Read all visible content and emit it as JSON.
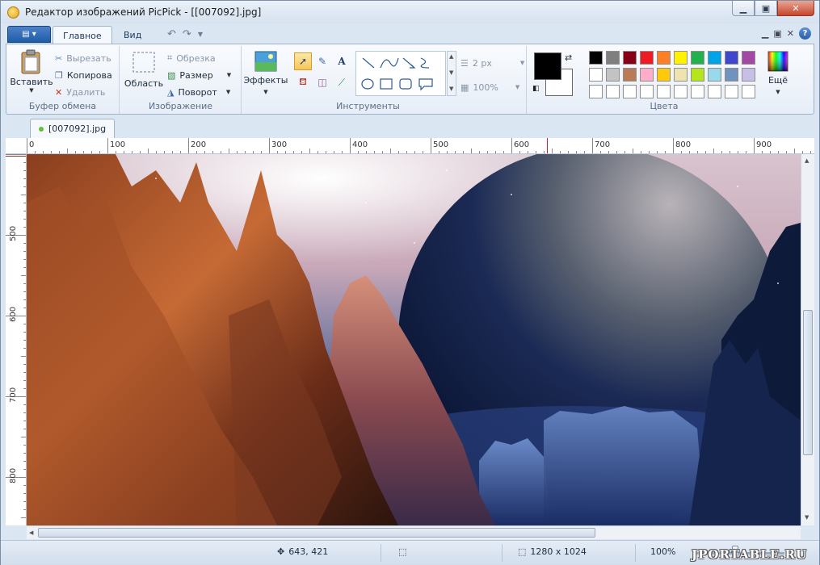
{
  "window": {
    "title": "Редактор изображений PicPick - [[007092].jpg]",
    "minimize_icon": "minimize-icon",
    "maximize_icon": "maximize-icon",
    "close_icon": "close-icon"
  },
  "ribbon_tabs": {
    "file_menu_icon": "menu-icon",
    "tabs": [
      {
        "label": "Главное",
        "active": true
      },
      {
        "label": "Вид",
        "active": false
      }
    ]
  },
  "clipboard_group": {
    "paste_label": "Вставить",
    "cut_label": "Вырезать",
    "copy_label": "Копирова",
    "delete_label": "Удалить",
    "group_label": "Буфер обмена"
  },
  "image_group": {
    "area_label": "Область",
    "crop_label": "Обрезка",
    "resize_label": "Размер",
    "rotate_label": "Поворот",
    "group_label": "Изображение"
  },
  "effects_group": {
    "effects_label": "Эффекты"
  },
  "tools_group": {
    "group_label": "Инструменты",
    "line_width": "2 px",
    "opacity": "100%"
  },
  "colors_group": {
    "group_label": "Цвета",
    "more_label": "Ещё",
    "primary_color": "#000000",
    "secondary_color": "#ffffff",
    "palette_row1": [
      "#000000",
      "#7f7f7f",
      "#880015",
      "#ed1c24",
      "#ff7f27",
      "#fff200",
      "#22b14c",
      "#00a2e8",
      "#3f48cc",
      "#a349a4"
    ],
    "palette_row2": [
      "#ffffff",
      "#c3c3c3",
      "#b97a57",
      "#ffaec9",
      "#ffc90e",
      "#efe4b0",
      "#b5e61d",
      "#99d9ea",
      "#7092be",
      "#c8bfe7"
    ],
    "palette_row3": [
      "#ffffff",
      "#ffffff",
      "#ffffff",
      "#ffffff",
      "#ffffff",
      "#ffffff",
      "#ffffff",
      "#ffffff",
      "#ffffff",
      "#ffffff"
    ]
  },
  "document": {
    "tab_label": "[007092].jpg"
  },
  "ruler": {
    "h_labels": [
      "0",
      "100",
      "200",
      "300",
      "400",
      "500",
      "600",
      "700",
      "800",
      "900"
    ],
    "v_labels": [
      "500",
      "600",
      "700",
      "800"
    ]
  },
  "statusbar": {
    "cursor_pos": "643, 421",
    "image_size": "1280 x 1024",
    "zoom": "100%",
    "watermark": "JPORTABLE.RU"
  }
}
